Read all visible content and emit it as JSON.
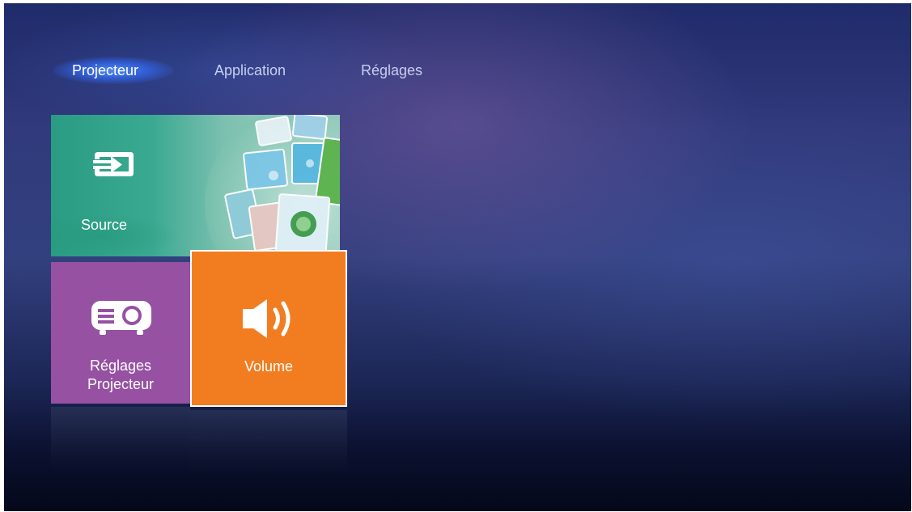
{
  "tabs": [
    {
      "label": "Projecteur",
      "active": true
    },
    {
      "label": "Application",
      "active": false
    },
    {
      "label": "Réglages",
      "active": false
    }
  ],
  "tiles": {
    "source": {
      "label": "Source",
      "icon": "input-arrow-icon",
      "color": "#3aa991"
    },
    "projector_settings": {
      "label_line1": "Réglages",
      "label_line2": "Projecteur",
      "icon": "projector-icon",
      "color": "#9651a3"
    },
    "volume": {
      "label": "Volume",
      "icon": "speaker-icon",
      "color": "#f27d21",
      "selected": true
    }
  },
  "colors": {
    "background": "#2b3575",
    "tab_highlight": "#4a82f0"
  }
}
